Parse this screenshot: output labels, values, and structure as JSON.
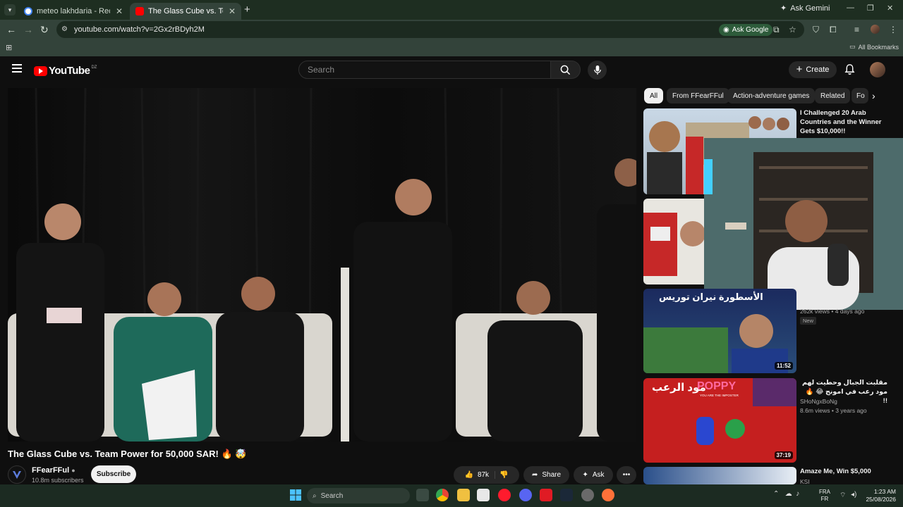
{
  "browser": {
    "tabs": [
      {
        "title": "meteo lakhdaria - Recherche G",
        "favicon_color": "#4285f4"
      },
      {
        "title": "The Glass Cube vs. Team Power",
        "favicon_color": "#ff0000"
      }
    ],
    "gemini_label": "Ask Gemini",
    "url": "youtube.com/watch?v=2Gx2rBDyh2M",
    "ask_google_label": "Ask Google",
    "all_bookmarks_label": "All Bookmarks"
  },
  "youtube": {
    "logo_text": "YouTube",
    "country_code": "DZ",
    "search_placeholder": "Search",
    "create_label": "Create"
  },
  "video": {
    "title": "The Glass Cube vs. Team Power for 50,000 SAR! 🔥 🤯",
    "channel": "FFearFFul",
    "subscribers": "10.8m subscribers",
    "subscribe_label": "Subscribe",
    "likes": "87k",
    "share_label": "Share",
    "ask_label": "Ask"
  },
  "chips": [
    "All",
    "From FFearFFul",
    "Action-adventure games",
    "Related",
    "Fo"
  ],
  "related": [
    {
      "title": "I Challenged 20 Arab Countries and the Winner Gets $10,000!!",
      "channel": "",
      "meta": "",
      "duration": ""
    },
    {
      "title": "",
      "channel": "",
      "meta": "",
      "duration": ""
    },
    {
      "title": "",
      "channel": "",
      "meta": "262k views • 4 days ago",
      "duration": "11:52",
      "badge": "New",
      "thumb_text": "الأسطورة نيران توريس"
    },
    {
      "title": "مقلبت الجبال وحطيت لهم مود رعب في امونج 😂 🔥 !!",
      "channel": "SHoNgxBoNg",
      "meta": "8.6m views • 3 years ago",
      "duration": "37:19",
      "thumb_text_ar": "مود الرعب",
      "thumb_text_en": "POPPY",
      "thumb_sub": "YOU ARE THE IMPOSTER"
    },
    {
      "title": "Amaze Me, Win $5,000",
      "channel": "KSI",
      "meta": "",
      "duration": ""
    }
  ],
  "taskbar": {
    "search_label": "Search",
    "lang_top": "FRA",
    "lang_bottom": "FR",
    "time": "1:23 AM",
    "date": "25/08/2026"
  },
  "colors": {
    "chrome_dark": "#1e2e21",
    "chrome": "#33433a",
    "yt_bg": "#0f0f0f",
    "yt_red": "#ff0000"
  }
}
